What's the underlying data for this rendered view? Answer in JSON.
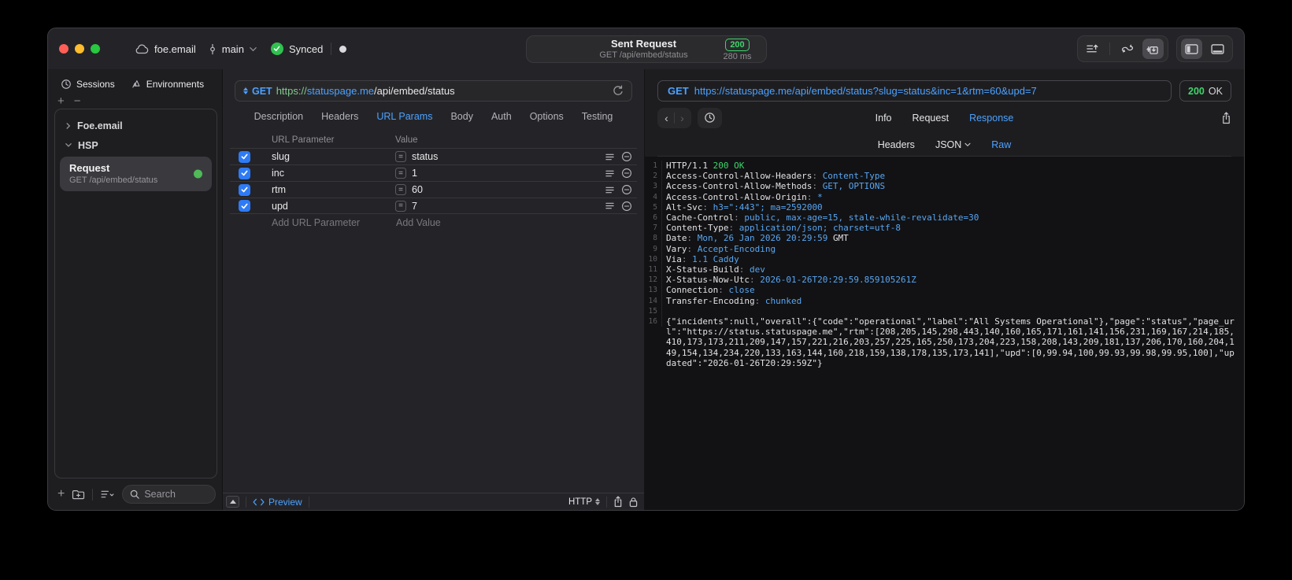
{
  "window": {
    "project": "foe.email",
    "branch": "main",
    "sync_status": "Synced",
    "title": "Sent Request",
    "subtitle": "GET /api/embed/status",
    "status_code": "200",
    "duration": "280 ms"
  },
  "colors": {
    "accent_blue": "#4ca2ff",
    "success_green": "#3fd56a",
    "checkbox_blue": "#2e7bf6",
    "url_scheme_green": "#84c98e"
  },
  "sidebar": {
    "tabs": [
      {
        "label": "Sessions"
      },
      {
        "label": "Environments"
      }
    ],
    "tree": [
      {
        "label": "Foe.email",
        "expanded": false
      },
      {
        "label": "HSP",
        "expanded": true
      }
    ],
    "request_item": {
      "title": "Request",
      "subtitle": "GET /api/embed/status"
    },
    "search_placeholder": "Search"
  },
  "request_panel": {
    "method": "GET",
    "url_scheme": "https://",
    "url_host": "statuspage.me",
    "url_path": "/api/embed/status",
    "tabs": [
      "Description",
      "Headers",
      "URL Params",
      "Body",
      "Auth",
      "Options",
      "Testing"
    ],
    "active_tab": "URL Params",
    "table": {
      "columns": [
        "URL Parameter",
        "Value"
      ],
      "rows": [
        {
          "name": "slug",
          "value": "status",
          "enabled": true
        },
        {
          "name": "inc",
          "value": "1",
          "enabled": true
        },
        {
          "name": "rtm",
          "value": "60",
          "enabled": true
        },
        {
          "name": "upd",
          "value": "7",
          "enabled": true
        }
      ],
      "add_name_placeholder": "Add URL Parameter",
      "add_value_placeholder": "Add Value"
    },
    "footer": {
      "preview_label": "Preview",
      "protocol": "HTTP"
    }
  },
  "response_panel": {
    "method": "GET",
    "url": "https://statuspage.me/api/embed/status?slug=status&inc=1&rtm=60&upd=7",
    "status_code": "200",
    "status_text": "OK",
    "tabs": [
      "Info",
      "Request",
      "Response"
    ],
    "active_tab": "Response",
    "subtabs": [
      "Headers",
      "JSON",
      "Raw"
    ],
    "active_subtab": "Raw",
    "raw_lines": [
      {
        "num": "1",
        "segments": [
          {
            "t": "HTTP/1.1 ",
            "c": "w"
          },
          {
            "t": "200 OK",
            "c": "g"
          }
        ]
      },
      {
        "num": "2",
        "segments": [
          {
            "t": "Access-Control-Allow-Headers",
            "c": "w"
          },
          {
            "t": ": ",
            "c": "gy"
          },
          {
            "t": "Content-Type",
            "c": "b"
          }
        ]
      },
      {
        "num": "3",
        "segments": [
          {
            "t": "Access-Control-Allow-Methods",
            "c": "w"
          },
          {
            "t": ": ",
            "c": "gy"
          },
          {
            "t": "GET, OPTIONS",
            "c": "b"
          }
        ]
      },
      {
        "num": "4",
        "segments": [
          {
            "t": "Access-Control-Allow-Origin",
            "c": "w"
          },
          {
            "t": ": ",
            "c": "gy"
          },
          {
            "t": "*",
            "c": "b"
          }
        ]
      },
      {
        "num": "5",
        "segments": [
          {
            "t": "Alt-Svc",
            "c": "w"
          },
          {
            "t": ": ",
            "c": "gy"
          },
          {
            "t": "h3=\":443\"; ma=2592000",
            "c": "b"
          }
        ]
      },
      {
        "num": "6",
        "segments": [
          {
            "t": "Cache-Control",
            "c": "w"
          },
          {
            "t": ": ",
            "c": "gy"
          },
          {
            "t": "public, max-age=15, stale-while-revalidate=30",
            "c": "b"
          }
        ]
      },
      {
        "num": "7",
        "segments": [
          {
            "t": "Content-Type",
            "c": "w"
          },
          {
            "t": ": ",
            "c": "gy"
          },
          {
            "t": "application/json; charset=utf-8",
            "c": "b"
          }
        ]
      },
      {
        "num": "8",
        "segments": [
          {
            "t": "Date",
            "c": "w"
          },
          {
            "t": ": ",
            "c": "gy"
          },
          {
            "t": "Mon, 26 Jan 2026 20:29:59 ",
            "c": "b"
          },
          {
            "t": "GMT",
            "c": "w"
          }
        ]
      },
      {
        "num": "9",
        "segments": [
          {
            "t": "Vary",
            "c": "w"
          },
          {
            "t": ": ",
            "c": "gy"
          },
          {
            "t": "Accept-Encoding",
            "c": "b"
          }
        ]
      },
      {
        "num": "10",
        "segments": [
          {
            "t": "Via",
            "c": "w"
          },
          {
            "t": ": ",
            "c": "gy"
          },
          {
            "t": "1.1 ",
            "c": "b"
          },
          {
            "t": "Caddy",
            "c": "b"
          }
        ]
      },
      {
        "num": "11",
        "segments": [
          {
            "t": "X-Status-Build",
            "c": "w"
          },
          {
            "t": ": ",
            "c": "gy"
          },
          {
            "t": "dev",
            "c": "b"
          }
        ]
      },
      {
        "num": "12",
        "segments": [
          {
            "t": "X-Status-Now-Utc",
            "c": "w"
          },
          {
            "t": ": ",
            "c": "gy"
          },
          {
            "t": "2026-01-26T20:29:59.859105261Z",
            "c": "b"
          }
        ]
      },
      {
        "num": "13",
        "segments": [
          {
            "t": "Connection",
            "c": "w"
          },
          {
            "t": ": ",
            "c": "gy"
          },
          {
            "t": "close",
            "c": "b"
          }
        ]
      },
      {
        "num": "14",
        "segments": [
          {
            "t": "Transfer-Encoding",
            "c": "w"
          },
          {
            "t": ": ",
            "c": "gy"
          },
          {
            "t": "chunked",
            "c": "b"
          }
        ]
      },
      {
        "num": "15",
        "segments": []
      },
      {
        "num": "16",
        "segments": [
          {
            "t": "{\"incidents\":null,\"overall\":{\"code\":\"operational\",\"label\":\"All Systems Operational\"},\"page\":\"status\",\"page_url\":\"https://status.statuspage.me\",\"rtm\":[208,205,145,298,443,140,160,165,171,161,141,156,231,169,167,214,185,410,173,173,211,209,147,157,221,216,203,257,225,165,250,173,204,223,158,208,143,209,181,137,206,170,160,204,149,154,134,234,220,133,163,144,160,218,159,138,178,135,173,141],\"upd\":[0,99.94,100,99.93,99.98,99.95,100],\"updated\":\"2026-01-26T20:29:59Z\"}",
            "c": "w"
          }
        ]
      }
    ]
  }
}
